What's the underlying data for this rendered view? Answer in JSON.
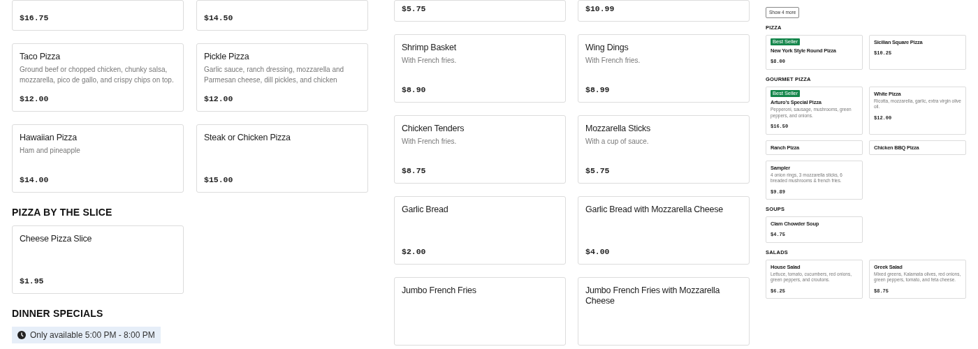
{
  "panels": [
    {
      "sections": [
        {
          "cards": [
            {
              "price": "$16.75"
            },
            {
              "price": "$14.50"
            },
            {
              "name": "Taco Pizza",
              "description": "Ground beef or chopped chicken, chunky salsa, mozzarella, pico de gallo, and crispy chips on top.",
              "price": "$12.00"
            },
            {
              "name": "Pickle Pizza",
              "description": "Garlic sauce, ranch dressing, mozzarella and Parmesan cheese, dill pickles, and chicken",
              "price": "$12.00"
            },
            {
              "name": "Hawaiian Pizza",
              "description": "Ham and pineapple",
              "price": "$14.00"
            },
            {
              "name": "Steak or Chicken Pizza",
              "price": "$15.00"
            }
          ]
        },
        {
          "heading": "PIZZA BY THE SLICE",
          "cards": [
            {
              "name": "Cheese Pizza Slice",
              "price": "$1.95"
            }
          ]
        },
        {
          "heading": "DINNER SPECIALS",
          "notice": "Only available 5:00 PM - 8:00 PM"
        }
      ]
    },
    {
      "sections": [
        {
          "cards": [
            {
              "price": "$5.75"
            },
            {
              "price": "$10.99"
            },
            {
              "name": "Shrimp Basket",
              "description": "With French fries.",
              "price": "$8.90"
            },
            {
              "name": "Wing Dings",
              "description": "With French fries.",
              "price": "$8.99"
            },
            {
              "name": "Chicken Tenders",
              "description": "With French fries.",
              "price": "$8.75"
            },
            {
              "name": "Mozzarella Sticks",
              "description": "With a cup of sauce.",
              "price": "$5.75"
            },
            {
              "name": "Garlic Bread",
              "price": "$2.00"
            },
            {
              "name": "Garlic Bread with Mozzarella Cheese",
              "price": "$4.00"
            },
            {
              "name": "Jumbo French Fries"
            },
            {
              "name": "Jumbo French Fries with Mozzarella Cheese"
            }
          ]
        }
      ]
    },
    {
      "sections": [
        {
          "button": "Show 4 more"
        },
        {
          "heading": "PIZZA",
          "cards": [
            {
              "badge": "Best Seller",
              "name": "New York Style Round Pizza",
              "price": "$8.00"
            },
            {
              "name": "Sicilian Square Pizza",
              "price": "$10.25"
            }
          ]
        },
        {
          "heading": "GOURMET PIZZA",
          "cards": [
            {
              "badge": "Best Seller",
              "name": "Arturo's Special Pizza",
              "description": "Pepperoni, sausage, mushrooms, green peppers, and onions.",
              "price": "$16.50"
            },
            {
              "name": "White Pizza",
              "description": "Ricotta, mozzarella, garlic, extra virgin olive oil.",
              "price": "$12.00"
            },
            {
              "name": "Ranch Pizza"
            },
            {
              "name": "Chicken BBQ Pizza"
            },
            {
              "name": "Sampler",
              "description": "4 onion rings, 3 mozzarella sticks, 6 breaded mushrooms & french fries.",
              "price": "$9.89"
            }
          ]
        },
        {
          "heading": "SOUPS",
          "cards": [
            {
              "name": "Clam Chowder Soup",
              "price": "$4.75"
            }
          ]
        },
        {
          "heading": "SALADS",
          "cards": [
            {
              "name": "House Salad",
              "description": "Lettuce, tomato, cucumbers, red onions, green peppers, and croutons.",
              "price": "$6.25"
            },
            {
              "name": "Greek Salad",
              "description": "Mixed greens, Kalamata olives, red onions, green peppers, tomato, and feta cheese.",
              "price": "$8.75"
            }
          ]
        }
      ]
    }
  ]
}
